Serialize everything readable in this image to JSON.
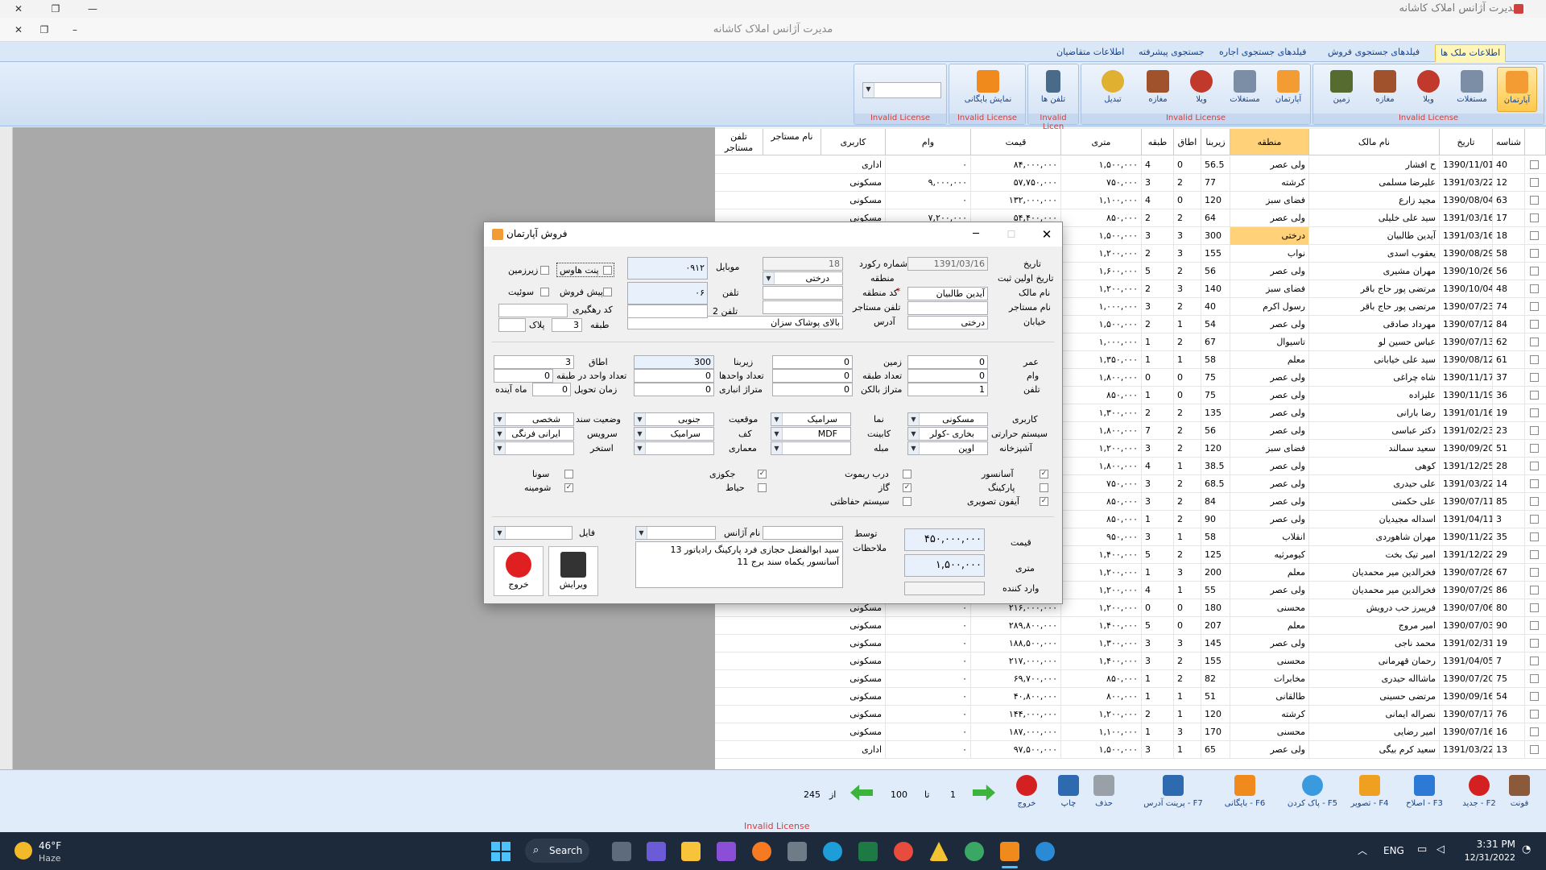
{
  "window": {
    "title": "مدیرت آژانس املاک کاشانه",
    "mdi_title": "مدیرت آژانس املاک کاشانه"
  },
  "ribbon_tabs": [
    "اطلاعات ملک ها",
    "فیلدهای جستجوی فروش",
    "فیلدهای جستجوی اجاره",
    "جستجوی پیشرفته",
    "اطلاعات متقاضیان"
  ],
  "ribbon_group1": {
    "buttons": [
      "آپارتمان",
      "مستغلات",
      "ویلا",
      "مغازه",
      "زمین"
    ],
    "label": "Invalid License"
  },
  "ribbon_group2": {
    "buttons": [
      "آپارتمان",
      "مستغلات",
      "ویلا",
      "مغازه",
      "تبدیل"
    ],
    "label": "Invalid License"
  },
  "ribbon_group3": {
    "buttons": [
      "تلفن ها"
    ],
    "label": "Invalid Licen"
  },
  "ribbon_group4": {
    "buttons": [
      "نمایش بایگانی"
    ],
    "label": "Invalid License"
  },
  "ribbon_group5": {
    "label": "Invalid License"
  },
  "grid": {
    "headers": [
      "شناسه",
      "تاریخ",
      "نام مالک",
      "منطقه",
      "زیربنا",
      "اطاق",
      "طبقه",
      "متری",
      "قیمت",
      "وام",
      "کاربری",
      "نام مستاجر",
      "تلفن مستاجر"
    ],
    "rows": [
      [
        "40",
        "1390/11/01",
        "ح افشار",
        "ولی عصر",
        "56.5",
        "0",
        "4",
        "۱,۵۰۰,۰۰۰",
        "۸۴,۰۰۰,۰۰۰",
        "۰",
        "اداری"
      ],
      [
        "12",
        "1391/03/22",
        "علیرضا مسلمی",
        "کرشته",
        "77",
        "2",
        "3",
        "۷۵۰,۰۰۰",
        "۵۷,۷۵۰,۰۰۰",
        "۹,۰۰۰,۰۰۰",
        "مسکونی"
      ],
      [
        "63",
        "1390/08/04",
        "مجید زارع",
        "فضای سبز",
        "120",
        "0",
        "4",
        "۱,۱۰۰,۰۰۰",
        "۱۳۲,۰۰۰,۰۰۰",
        "۰",
        "مسکونی"
      ],
      [
        "17",
        "1391/03/16",
        "سید علی خلیلی",
        "ولی عصر",
        "64",
        "2",
        "2",
        "۸۵۰,۰۰۰",
        "۵۴,۴۰۰,۰۰۰",
        "۷,۲۰۰,۰۰۰",
        "مسکونی"
      ],
      [
        "18",
        "1391/03/16",
        "آیدین طالبیان",
        "درختی",
        "300",
        "3",
        "3",
        "۱,۵۰۰,۰۰۰",
        "",
        "",
        ""
      ],
      [
        "58",
        "1390/08/29",
        "یعقوب اسدی",
        "نواب",
        "155",
        "3",
        "2",
        "۱,۲۰۰,۰۰۰",
        "",
        "",
        ""
      ],
      [
        "56",
        "1390/10/26",
        "مهران مشیری",
        "ولی عصر",
        "56",
        "2",
        "5",
        "۱,۶۰۰,۰۰۰",
        "",
        "",
        ""
      ],
      [
        "48",
        "1390/10/04",
        "مرتضی پور حاج باقر",
        "فضای سبز",
        "140",
        "3",
        "2",
        "۱,۲۰۰,۰۰۰",
        "",
        "",
        ""
      ],
      [
        "74",
        "1390/07/23",
        "مرتضی پور حاج باقر",
        "رسول اکرم",
        "40",
        "2",
        "3",
        "۱,۰۰۰,۰۰۰",
        "",
        "",
        ""
      ],
      [
        "84",
        "1390/07/12",
        "مهرداد صادقی",
        "ولی عصر",
        "54",
        "1",
        "2",
        "۱,۵۰۰,۰۰۰",
        "",
        "",
        ""
      ],
      [
        "62",
        "1390/07/13",
        "عباس حسین لو",
        "تاسیوال",
        "67",
        "2",
        "1",
        "۱,۰۰۰,۰۰۰",
        "",
        "",
        ""
      ],
      [
        "61",
        "1390/08/12",
        "سید علی خیابانی",
        "معلم",
        "58",
        "1",
        "1",
        "۱,۳۵۰,۰۰۰",
        "",
        "",
        ""
      ],
      [
        "37",
        "1390/11/17",
        "شاه چراغی",
        "ولی عصر",
        "75",
        "0",
        "0",
        "۱,۸۰۰,۰۰۰",
        "",
        "",
        ""
      ],
      [
        "36",
        "1390/11/19",
        "علیزاده",
        "ولی عصر",
        "75",
        "0",
        "1",
        "۸۵۰,۰۰۰",
        "",
        "",
        ""
      ],
      [
        "19",
        "1391/01/16",
        "رضا بارانی",
        "ولی عصر",
        "135",
        "2",
        "2",
        "۱,۳۰۰,۰۰۰",
        "",
        "",
        ""
      ],
      [
        "23",
        "1391/02/23",
        "دکتر عباسی",
        "ولی عصر",
        "56",
        "2",
        "7",
        "۱,۸۰۰,۰۰۰",
        "",
        "",
        ""
      ],
      [
        "51",
        "1390/09/20",
        "سعید سمالند",
        "فضای سبز",
        "120",
        "2",
        "3",
        "۱,۲۰۰,۰۰۰",
        "",
        "",
        ""
      ],
      [
        "28",
        "1391/12/25",
        "کوهی",
        "ولی عصر",
        "38.5",
        "1",
        "4",
        "۱,۸۰۰,۰۰۰",
        "",
        "",
        ""
      ],
      [
        "14",
        "1391/03/22",
        "علی حیدری",
        "ولی عصر",
        "68.5",
        "2",
        "3",
        "۷۵۰,۰۰۰",
        "",
        "",
        ""
      ],
      [
        "85",
        "1390/07/11",
        "علی حکمتی",
        "ولی عصر",
        "84",
        "2",
        "3",
        "۸۵۰,۰۰۰",
        "",
        "",
        ""
      ],
      [
        "3",
        "1391/04/11",
        "اسداله مجیدیان",
        "ولی عصر",
        "90",
        "2",
        "1",
        "۸۵۰,۰۰۰",
        "",
        "",
        ""
      ],
      [
        "35",
        "1390/11/22",
        "مهران شاهوردی",
        "انقلاب",
        "58",
        "1",
        "3",
        "۹۵۰,۰۰۰",
        "",
        "",
        ""
      ],
      [
        "29",
        "1391/12/22",
        "امیر تیک بخت",
        "کیومرثیه",
        "125",
        "2",
        "5",
        "۱,۴۰۰,۰۰۰",
        "",
        "",
        ""
      ],
      [
        "67",
        "1390/07/28",
        "فخرالدین میر محمدیان",
        "معلم",
        "200",
        "3",
        "1",
        "۱,۲۰۰,۰۰۰",
        "",
        "",
        ""
      ],
      [
        "86",
        "1390/07/29",
        "فخرالدین میر محمدیان",
        "ولی عصر",
        "55",
        "1",
        "4",
        "۱,۲۰۰,۰۰۰",
        "",
        "",
        ""
      ],
      [
        "80",
        "1390/07/06",
        "فریبرز حب درویش",
        "محسنی",
        "180",
        "0",
        "0",
        "۱,۲۰۰,۰۰۰",
        "۲۱۶,۰۰۰,۰۰۰",
        "۰",
        "مسکونی"
      ],
      [
        "90",
        "1390/07/03",
        "امیر مروج",
        "معلم",
        "207",
        "0",
        "5",
        "۱,۴۰۰,۰۰۰",
        "۲۸۹,۸۰۰,۰۰۰",
        "۰",
        "مسکونی"
      ],
      [
        "19",
        "1391/02/31",
        "محمد ناجی",
        "ولی عصر",
        "145",
        "3",
        "3",
        "۱,۳۰۰,۰۰۰",
        "۱۸۸,۵۰۰,۰۰۰",
        "۰",
        "مسکونی"
      ],
      [
        "7",
        "1391/04/05",
        "رحمان قهرمانی",
        "محسنی",
        "155",
        "2",
        "3",
        "۱,۴۰۰,۰۰۰",
        "۲۱۷,۰۰۰,۰۰۰",
        "۰",
        "مسکونی"
      ],
      [
        "75",
        "1390/07/20",
        "ماشااله حیدری",
        "مخابرات",
        "82",
        "2",
        "1",
        "۸۵۰,۰۰۰",
        "۶۹,۷۰۰,۰۰۰",
        "۰",
        "مسکونی"
      ],
      [
        "54",
        "1390/09/16",
        "مرتضی حسینی",
        "طالقانی",
        "51",
        "1",
        "1",
        "۸۰۰,۰۰۰",
        "۴۰,۸۰۰,۰۰۰",
        "۰",
        "مسکونی"
      ],
      [
        "76",
        "1390/07/17",
        "نصراله ایمانی",
        "کرشته",
        "120",
        "1",
        "2",
        "۱,۲۰۰,۰۰۰",
        "۱۴۴,۰۰۰,۰۰۰",
        "۰",
        "مسکونی"
      ],
      [
        "16",
        "1390/07/16",
        "امیر رضایی",
        "محسنی",
        "170",
        "3",
        "1",
        "۱,۱۰۰,۰۰۰",
        "۱۸۷,۰۰۰,۰۰۰",
        "۰",
        "مسکونی"
      ],
      [
        "13",
        "1391/03/22",
        "سعید کرم بیگی",
        "ولی عصر",
        "65",
        "1",
        "3",
        "۱,۵۰۰,۰۰۰",
        "۹۷,۵۰۰,۰۰۰",
        "۰",
        "اداری"
      ]
    ]
  },
  "bottom": {
    "buttons": [
      "فونت",
      "جدید - F2",
      "اصلاح - F3",
      "تصویر - F4",
      "پاک کردن - F5",
      "بایگانی - F6",
      "پرینت آدرس - F7",
      "حذف",
      "چاپ",
      "خروج"
    ],
    "page_from": "1",
    "page_to": "100",
    "label_ta": "تا",
    "label_az": "از",
    "total": "245",
    "license": "Invalid License"
  },
  "dialog": {
    "title": "فروش آپارتمان",
    "labels": {
      "tarikh": "تاریخ",
      "tarikh_sabt": "تاریخ اولین ثبت",
      "nam_malek": "نام مالک",
      "nam_mostajer": "نام مستاجر",
      "khiaban": "خیابان",
      "shomare": "شماره رکورد",
      "mantaghe": "منطقه",
      "kod_mantaghe": "کد منطقه",
      "tel_mostajer": "تلفن مستاجر",
      "adres": "آدرس",
      "mobile": "موبایل",
      "telefon": "تلفن",
      "telefon2": "تلفن 2",
      "kod_rahgiri": "کد رهگیری",
      "tabaghe": "طبقه",
      "pelak": "پلاک",
      "omr": "عمر",
      "vam": "وام",
      "tolfon": "تلفن",
      "zamin": "زمین",
      "tedad_tabaghe": "تعداد طبقه",
      "metraj_balkon": "متراژ بالکن",
      "zirbana": "زیربنا",
      "tedad_vahedha": "تعداد واحدها",
      "metraj_anbari": "متراژ انباری",
      "otagh": "اطاق",
      "vahed_dar_tabaghe": "تعداد واحد در طبقه",
      "zaman_tahvil": "زمان تحویل",
      "mah_ayande": "ماه آینده",
      "karbari": "کاربری",
      "system_harorati": "سیستم حرارتی",
      "ashpazkhane": "آشپزخانه",
      "nama": "نما",
      "kabinet": "کابینت",
      "mobleh": "مبله",
      "mogheiat": "موقعیت",
      "kaf": "کف",
      "memari": "معماری",
      "vaziat_sanad": "وضعیت سند",
      "servis": "سرویس",
      "estakhr": "استخر",
      "gheymat": "قیمت",
      "metri": "متری",
      "vared_konande": "وارد کننده",
      "tavasot": "توسط",
      "molahezat": "ملاحظات",
      "nam_ajans": "نام آژانس",
      "fayl": "فایل"
    },
    "values": {
      "tarikh": "1391/03/16",
      "shomare": "18",
      "mantaghe": "درختی",
      "nam_malek": "آیدین   طالبیان",
      "khiaban": "درختی",
      "adres": "بالای پوشاک  سزان",
      "mobile": "۰۹۱۲",
      "telefon": "۰۶",
      "tabaghe": "3",
      "omr": "0",
      "vam": "0",
      "tolfon": "1",
      "zamin": "0",
      "tedad_tabaghe": "0",
      "metraj_balkon": "0",
      "zirbana": "300",
      "tedad_vahedha": "0",
      "metraj_anbari": "0",
      "otagh": "3",
      "vahed_dar_tabaghe": "0",
      "zaman_tahvil": "0",
      "karbari": "مسکونی",
      "system_harorati": "بخاری -کولر",
      "ashpazkhane": "اوپن",
      "nama": "سرامیک",
      "kabinet": "MDF",
      "mogheiat": "جنوبی",
      "kaf": "سرامیک",
      "vaziat_sanad": "شخصی",
      "servis": "ایرانی فرنگی",
      "gheymat": "۴۵۰,۰۰۰,۰۰۰",
      "metri": "۱,۵۰۰,۰۰۰",
      "molahezat": "13  سید  ابوالفضل  حجازی  فرد  پارکینگ رادیاتور  آسانسور یکماه  سند  برج 11"
    },
    "checks_top": [
      {
        "label": "پنت هاوس",
        "checked": false
      },
      {
        "label": "زیرزمین",
        "checked": false
      },
      {
        "label": "پیش فروش",
        "checked": false
      },
      {
        "label": "سوئیت",
        "checked": false
      }
    ],
    "checks": [
      {
        "label": "آسانسور",
        "checked": true
      },
      {
        "label": "پارکینگ",
        "checked": false
      },
      {
        "label": "آیفون تصویری",
        "checked": true
      },
      {
        "label": "درب ریموت",
        "checked": false
      },
      {
        "label": "گاز",
        "checked": true
      },
      {
        "label": "سیستم حفاظتی",
        "checked": false
      },
      {
        "label": "جکوزی",
        "checked": true
      },
      {
        "label": "حیاط",
        "checked": false
      },
      {
        "label": "سونا",
        "checked": false
      },
      {
        "label": "شومینه",
        "checked": true
      }
    ],
    "buttons": {
      "edit": "ویرایش",
      "exit": "خروج"
    },
    "required_mark": "*"
  },
  "taskbar": {
    "weather_temp": "46°F",
    "weather_desc": "Haze",
    "search": "Search",
    "lang": "ENG",
    "time": "3:31 PM",
    "date": "12/31/2022"
  }
}
